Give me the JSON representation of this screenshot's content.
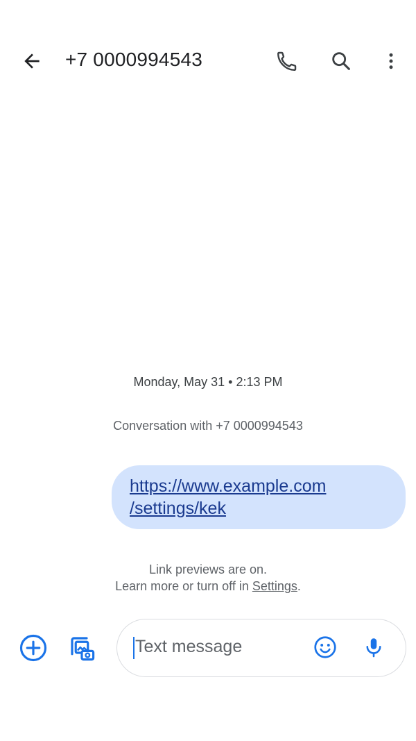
{
  "header": {
    "title": "+7 0000994543",
    "icons": {
      "back": "arrow-back-icon",
      "call": "phone-icon",
      "search": "search-icon",
      "more": "more-vert-icon"
    }
  },
  "conversation": {
    "timestamp": "Monday, May 31 • 2:13 PM",
    "conversation_with": "Conversation with +7 0000994543",
    "messages": [
      {
        "line1": "https://www.example.com",
        "line2": "/settings/kek"
      }
    ],
    "link_note_line1": "Link previews are on.",
    "link_note_line2_prefix": "Learn more or turn off in ",
    "link_note_settings": "Settings",
    "link_note_suffix": "."
  },
  "compose": {
    "placeholder": "Text message",
    "icons": {
      "add": "add-circle-icon",
      "media": "gallery-camera-icon",
      "emoji": "emoji-icon",
      "mic": "mic-icon"
    }
  },
  "colors": {
    "accent": "#1a73e8",
    "bubble": "#d3e3fd",
    "link": "#1a3a8f"
  }
}
